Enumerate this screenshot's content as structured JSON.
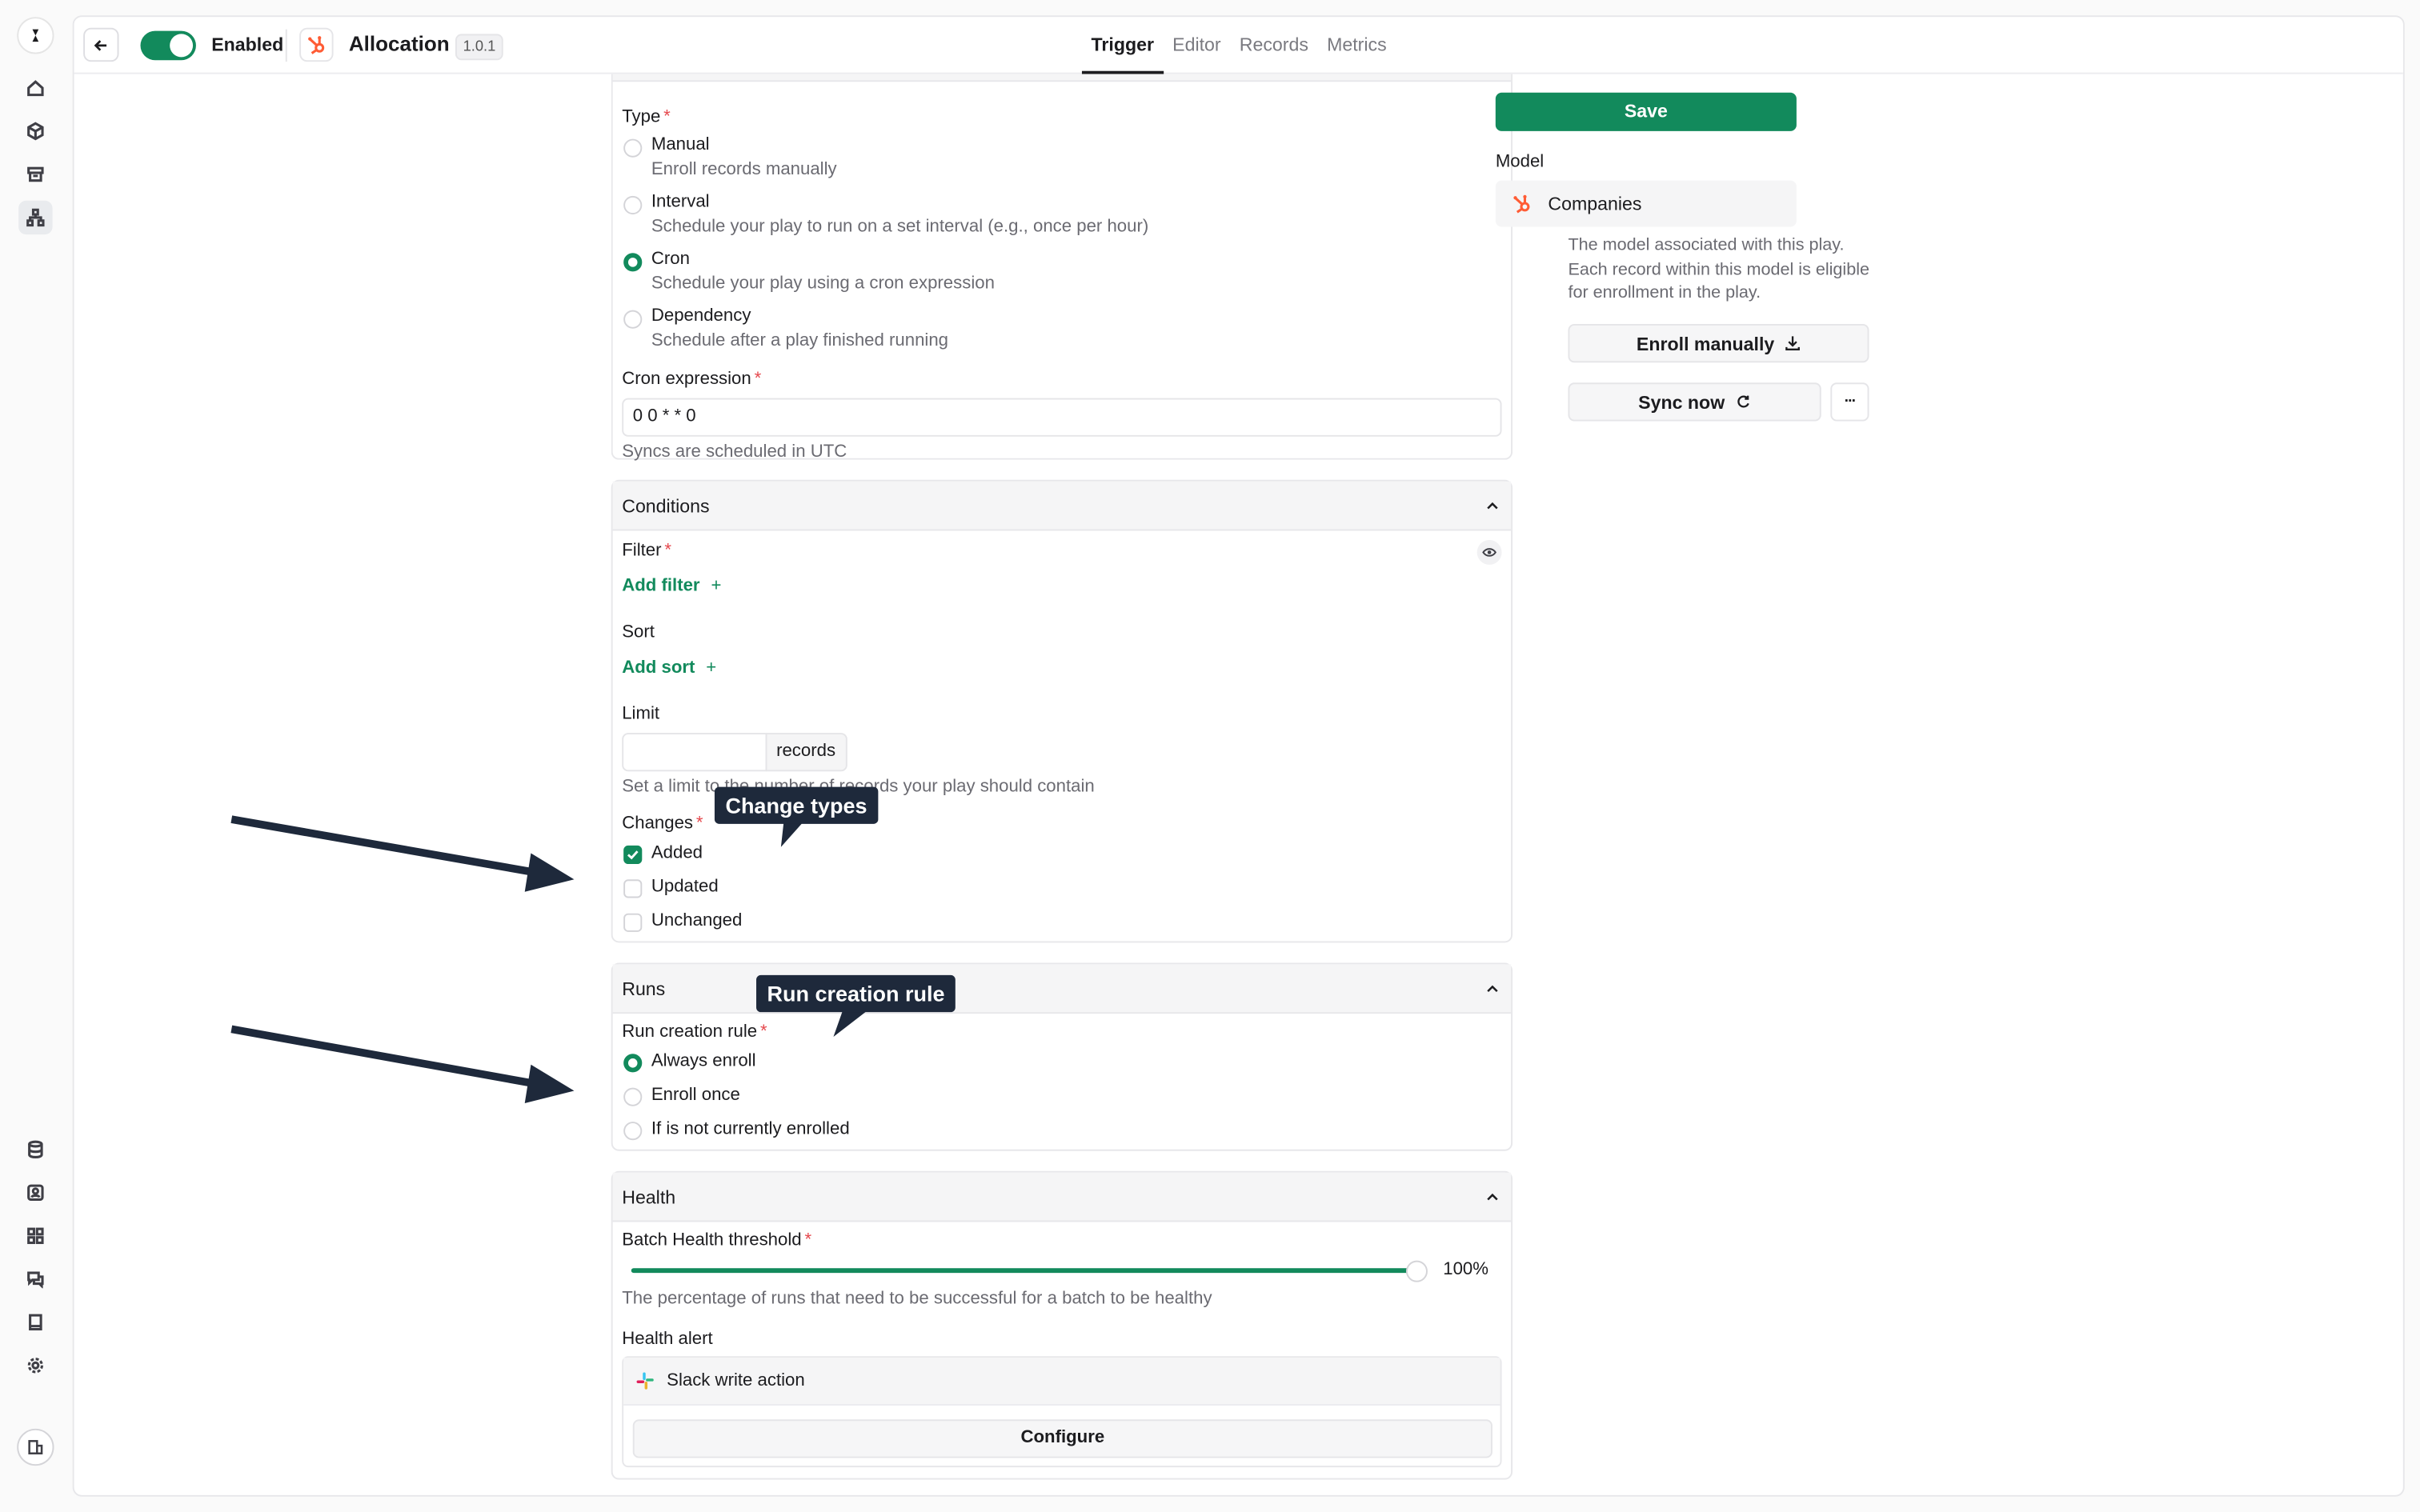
{
  "topbar": {
    "enabled_label": "Enabled",
    "title": "Allocation",
    "version": "1.0.1",
    "tabs": [
      {
        "label": "Trigger",
        "active": true
      },
      {
        "label": "Editor",
        "active": false
      },
      {
        "label": "Records",
        "active": false
      },
      {
        "label": "Metrics",
        "active": false
      }
    ]
  },
  "rail": {
    "icons": [
      "home-icon",
      "cube-icon",
      "archive-icon",
      "sitemap-icon",
      "database-icon",
      "contact-icon",
      "grid-icon",
      "chat-icon",
      "book-icon",
      "settings-icon"
    ],
    "active": "sitemap-icon"
  },
  "trigger": {
    "type_label": "Type",
    "options": [
      {
        "label": "Manual",
        "desc": "Enroll records manually",
        "selected": false
      },
      {
        "label": "Interval",
        "desc": "Schedule your play to run on a set interval (e.g., once per hour)",
        "selected": false
      },
      {
        "label": "Cron",
        "desc": "Schedule your play using a cron expression",
        "selected": true
      },
      {
        "label": "Dependency",
        "desc": "Schedule after a play finished running",
        "selected": false
      }
    ],
    "cron_label": "Cron expression",
    "cron_value": "0 0 * * 0",
    "cron_help": "Syncs are scheduled in UTC"
  },
  "conditions": {
    "title": "Conditions",
    "filter_label": "Filter",
    "add_filter": "Add filter",
    "sort_label": "Sort",
    "add_sort": "Add sort",
    "limit_label": "Limit",
    "limit_value": "",
    "limit_suffix": "records",
    "limit_help": "Set a limit to the number of records your play should contain",
    "changes_label": "Changes",
    "changes": [
      {
        "label": "Added",
        "checked": true
      },
      {
        "label": "Updated",
        "checked": false
      },
      {
        "label": "Unchanged",
        "checked": false
      }
    ]
  },
  "runs": {
    "title": "Runs",
    "rule_label": "Run creation rule",
    "options": [
      {
        "label": "Always enroll",
        "selected": true
      },
      {
        "label": "Enroll once",
        "selected": false
      },
      {
        "label": "If is not currently enrolled",
        "selected": false
      }
    ]
  },
  "health": {
    "title": "Health",
    "threshold_label": "Batch Health threshold",
    "threshold_value": "100%",
    "threshold_fraction": 1.0,
    "threshold_help": "The percentage of runs that need to be successful for a batch to be healthy",
    "alert_label": "Health alert",
    "alert_action": "Slack write action",
    "configure": "Configure"
  },
  "sidebar": {
    "save": "Save",
    "model_label": "Model",
    "model_value": "Companies",
    "model_help": "The model associated with this play. Each record within this model is eligible for enrollment in the play.",
    "enroll_manually": "Enroll manually",
    "sync_now": "Sync now",
    "more": "···"
  },
  "callouts": {
    "change_types": "Change types",
    "run_creation_rule": "Run creation rule"
  },
  "colors": {
    "accent": "#128a5c",
    "required": "#e5484d",
    "hubspot": "#ff5c35",
    "callout_bg": "#1e293b"
  }
}
